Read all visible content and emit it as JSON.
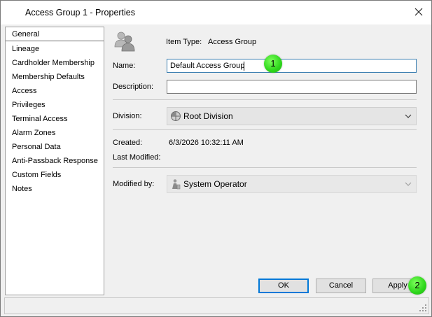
{
  "window": {
    "title": "Access Group 1 - Properties"
  },
  "sidebar": {
    "items": [
      {
        "label": "General",
        "selected": true
      },
      {
        "label": "Lineage"
      },
      {
        "label": "Cardholder Membership"
      },
      {
        "label": "Membership Defaults"
      },
      {
        "label": "Access"
      },
      {
        "label": "Privileges"
      },
      {
        "label": "Terminal Access"
      },
      {
        "label": "Alarm Zones"
      },
      {
        "label": "Personal Data"
      },
      {
        "label": "Anti-Passback Response"
      },
      {
        "label": "Custom Fields"
      },
      {
        "label": "Notes"
      }
    ]
  },
  "general": {
    "item_type_label": "Item Type:",
    "item_type_value": "Access Group",
    "name_label": "Name:",
    "name_value": "Default Access Group",
    "description_label": "Description:",
    "description_value": "",
    "division_label": "Division:",
    "division_value": "Root Division",
    "created_label": "Created:",
    "created_value": "6/3/2026 10:32:11 AM",
    "last_modified_label": "Last Modified:",
    "last_modified_value": "",
    "modified_by_label": "Modified by:",
    "modified_by_value": "System Operator"
  },
  "buttons": {
    "ok": "OK",
    "cancel": "Cancel",
    "apply": "Apply"
  },
  "markers": {
    "one": "1",
    "two": "2"
  },
  "colors": {
    "marker_green": "#2dd61b",
    "focus_blue": "#3c7fb1",
    "default_button": "#0078d7"
  }
}
